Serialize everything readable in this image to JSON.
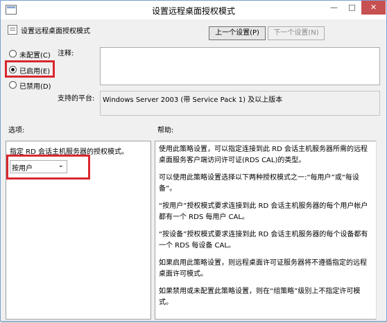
{
  "window": {
    "title": "设置远程桌面授权模式",
    "minimize_glyph": "—",
    "maximize_glyph": "□",
    "close_glyph": "✕"
  },
  "header": {
    "policy_name": "设置远程桌面授权模式",
    "prev_setting_label": "上一个设置(P)",
    "next_setting_label": "下一个设置(N)"
  },
  "state_options": [
    {
      "label": "未配置(C)",
      "checked": false
    },
    {
      "label": "已启用(E)",
      "checked": true
    },
    {
      "label": "已禁用(D)",
      "checked": false
    }
  ],
  "comment": {
    "label": "注释:",
    "value": ""
  },
  "platform": {
    "label": "支持的平台:",
    "value": "Windows Server 2003 (带 Service Pack 1) 及以上版本"
  },
  "options": {
    "header": "选项:",
    "description": "指定 RD 会话主机服务器的授权模式。",
    "mode_select_value": "按用户",
    "chevron": "⌄"
  },
  "help": {
    "header": "帮助:",
    "paragraphs": [
      "使用此策略设置，可以指定连接到此 RD 会话主机服务器所需的远程桌面服务客户端访问许可证(RDS CAL)的类型。",
      "可以使用此策略设置选择以下两种授权模式之一:“每用户”或“每设备”。",
      "“按用户”授权模式要求连接到此 RD 会话主机服务器的每个用户帐户都有一个 RDS 每用户 CAL。",
      "“按设备”授权模式要求连接到此 RD 会话主机服务器的每个设备都有一个 RDS 每设备 CAL。",
      "如果启用此策略设置，则远程桌面许可证服务器将不遵循指定的远程桌面许可模式。",
      "如果禁用或未配置此策略设置，则在“组策略”级别上不指定许可模式。"
    ]
  },
  "colors": {
    "highlight_frame": "#d9272e",
    "title_bar_close": "#c75050",
    "window_border": "#7a9fd3"
  }
}
